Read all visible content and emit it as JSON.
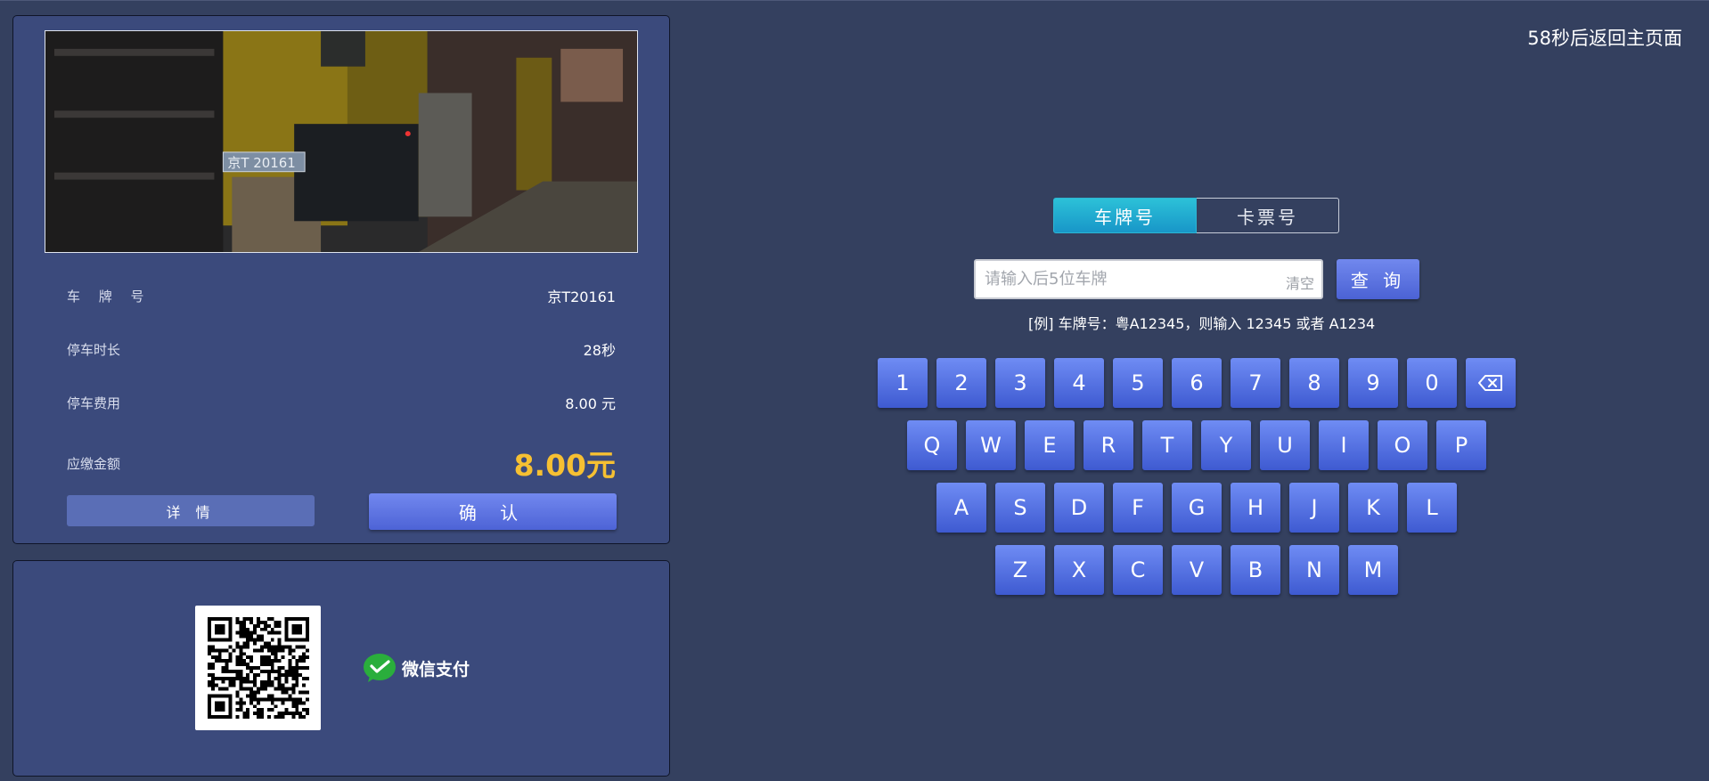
{
  "countdown": "58秒后返回主页面",
  "info": {
    "plate_label": "车 牌 号",
    "plate_value": "京T20161",
    "duration_label": "停车时长",
    "duration_value": "28秒",
    "fee_label": "停车费用",
    "fee_value": "8.00 元",
    "due_label": "应缴金额",
    "due_value": "8.00元",
    "detail_button": "详 情",
    "confirm_button": "确 认",
    "camera_plate_text": "京T 20161"
  },
  "payment": {
    "method_label": "微信支付"
  },
  "tabs": [
    {
      "label": "车牌号",
      "active": true
    },
    {
      "label": "卡票号",
      "active": false
    }
  ],
  "search": {
    "placeholder": "请输入后5位车牌",
    "value": "",
    "clear_label": "清空",
    "query_button": "查 询",
    "hint": "[例] 车牌号：粤A12345，则输入 12345 或者 A1234"
  },
  "keyboard": {
    "row1": [
      "1",
      "2",
      "3",
      "4",
      "5",
      "6",
      "7",
      "8",
      "9",
      "0"
    ],
    "row2": [
      "Q",
      "W",
      "E",
      "R",
      "T",
      "Y",
      "U",
      "I",
      "O",
      "P"
    ],
    "row3": [
      "A",
      "S",
      "D",
      "F",
      "G",
      "H",
      "J",
      "K",
      "L"
    ],
    "row4": [
      "Z",
      "X",
      "C",
      "V",
      "B",
      "N",
      "M"
    ]
  },
  "colors": {
    "background": "#34405f",
    "panel": "#3b4a7c",
    "amount": "#f6c032",
    "key": "#5073e0",
    "tab_active": "#22a9d0"
  }
}
